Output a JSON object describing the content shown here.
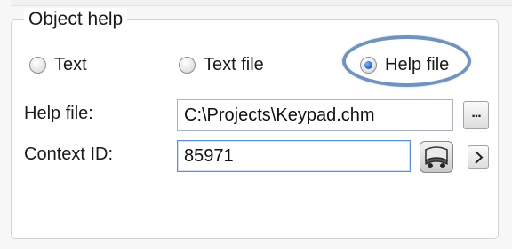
{
  "group": {
    "title": "Object help"
  },
  "radios": [
    {
      "label": "Text",
      "checked": false
    },
    {
      "label": "Text file",
      "checked": false
    },
    {
      "label": "Help file",
      "checked": true
    }
  ],
  "fields": {
    "help_file": {
      "label": "Help file:",
      "value": "C:\\Projects\\Keypad.chm",
      "browse_label": "..."
    },
    "context_id": {
      "label": "Context ID:",
      "value": "85971"
    }
  },
  "icons": {
    "highlight": "ellipse-highlight",
    "context_picker": "id-picker-icon",
    "next": "chevron-right-icon"
  },
  "colors": {
    "highlight": "#6f93bd",
    "focus_border": "#5b8fd6",
    "radio_selected": "#1c5fc9"
  }
}
